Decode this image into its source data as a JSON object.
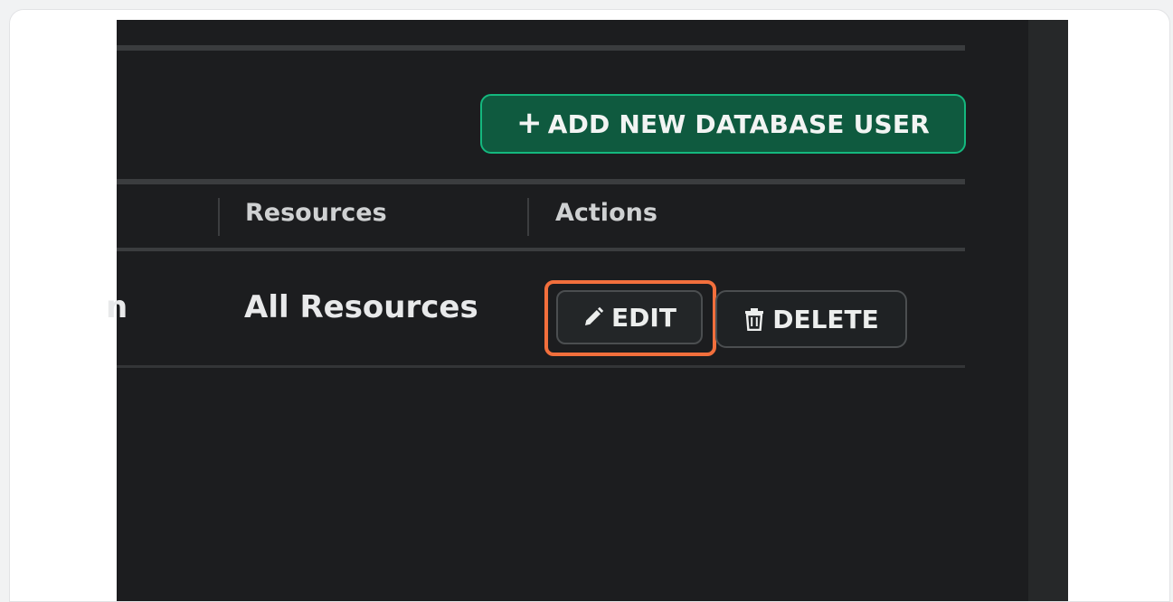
{
  "toolbar": {
    "add_button": {
      "icon": "plus-icon",
      "label": "ADD NEW DATABASE USER"
    }
  },
  "table": {
    "headers": [
      "Resources",
      "Actions"
    ],
    "rows": [
      {
        "partial_cell": "n",
        "resources": "All Resources",
        "edit": {
          "icon": "pencil-icon",
          "label": "EDIT"
        },
        "delete": {
          "icon": "trash-icon",
          "label": "DELETE"
        }
      }
    ]
  },
  "colors": {
    "accent_green": "#14b87e",
    "highlight_orange": "#f26f3c",
    "background": "#1c1d1f"
  }
}
